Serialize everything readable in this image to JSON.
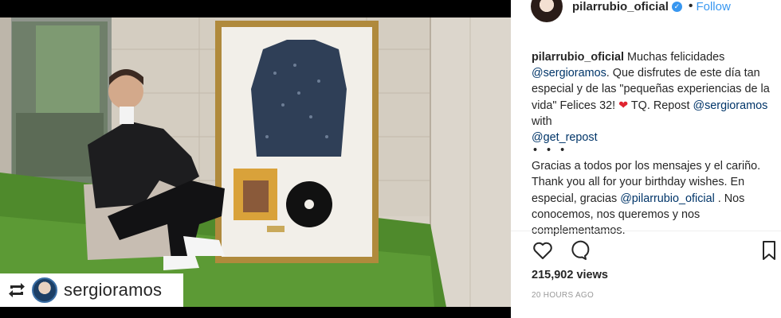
{
  "post": {
    "reposted_user": "sergioramos",
    "author": "pilarrubio_oficial",
    "follow_label": "Follow",
    "separator": "•",
    "caption_user": "pilarrubio_oficial",
    "caption_line1": " Muchas felicidades",
    "mention_sergio": "@sergioramos",
    "caption_line2": ". Que disfrutes de este día tan especial y de las \"pequeñas experiencias de la vida\" Felices 32! ",
    "heart": "❤",
    "caption_line3": " TQ. Repost ",
    "mention_sergio_2": "@sergioramos",
    "caption_line4": " with",
    "mention_get_repost": "@get_repost",
    "dots": "• • •",
    "caption_para2": "Gracias a todos por los mensajes y el cariño. Thank you all for your birthday wishes. En especial, gracias ",
    "mention_pilar": "@pilarrubio_oficial",
    "caption_para2_end": " . Nos conocemos, nos queremos y nos complementamos.",
    "views": "215,902 views",
    "timestamp": "20 HOURS AGO"
  },
  "icons": {
    "like": "heart-outline-icon",
    "comment": "comment-bubble-icon",
    "save": "bookmark-icon",
    "repost": "repost-arrows-icon",
    "verified": "verified-badge-icon"
  },
  "colors": {
    "link": "#003569",
    "follow": "#3897f0",
    "heart": "#e0242f",
    "timestamp": "#999999"
  }
}
